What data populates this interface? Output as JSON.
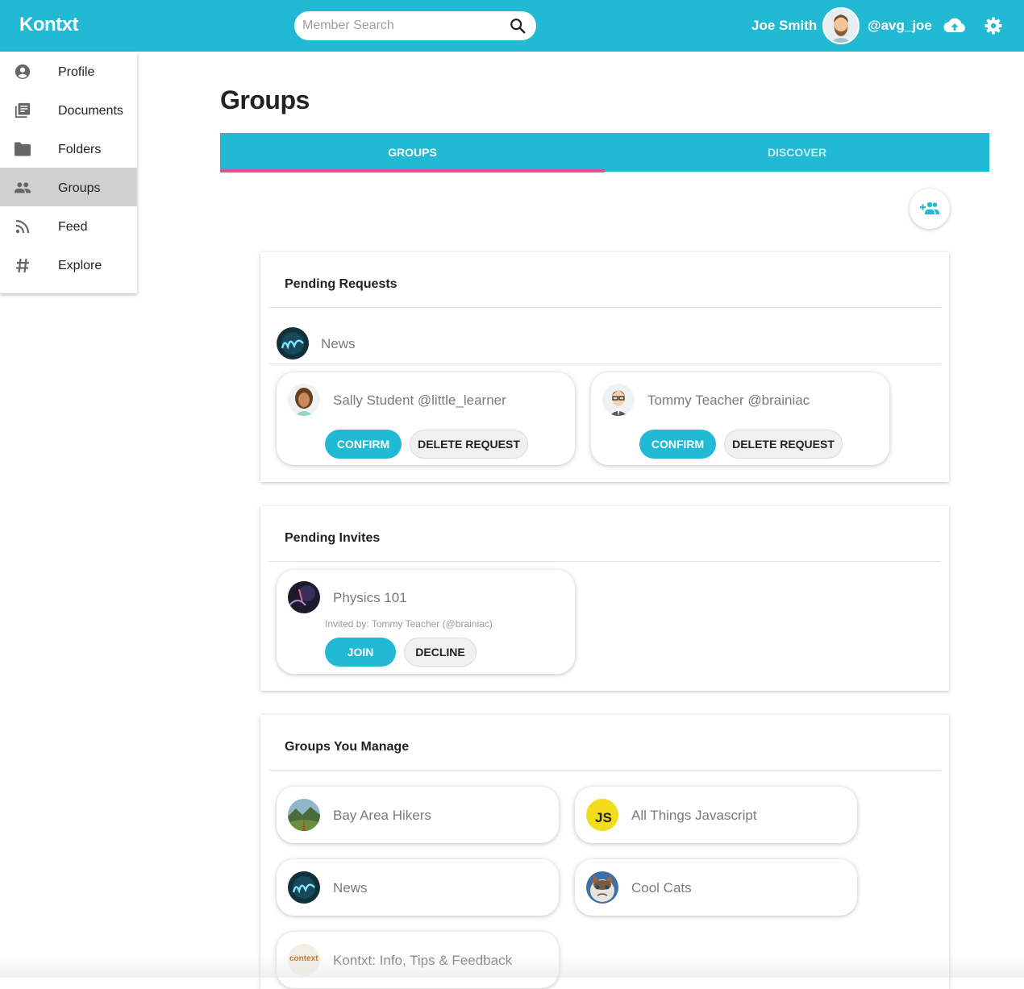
{
  "app": {
    "brand": "Kontxt"
  },
  "header": {
    "search_placeholder": "Member Search",
    "user_name": "Joe Smith",
    "user_handle": "@avg_joe"
  },
  "sidebar": {
    "items": [
      {
        "label": "Profile",
        "icon": "account-circle-icon"
      },
      {
        "label": "Documents",
        "icon": "documents-icon"
      },
      {
        "label": "Folders",
        "icon": "folder-icon"
      },
      {
        "label": "Groups",
        "icon": "people-icon",
        "active": true
      },
      {
        "label": "Feed",
        "icon": "rss-icon"
      },
      {
        "label": "Explore",
        "icon": "hashtag-icon"
      }
    ]
  },
  "main": {
    "title": "Groups",
    "tabs": [
      {
        "label": "GROUPS",
        "active": true
      },
      {
        "label": "DISCOVER",
        "active": false
      }
    ]
  },
  "pending_requests": {
    "title": "Pending Requests",
    "group_name": "News",
    "requests": [
      {
        "name": "Sally Student @little_learner",
        "confirm_label": "CONFIRM",
        "delete_label": "DELETE REQUEST"
      },
      {
        "name": "Tommy Teacher @brainiac",
        "confirm_label": "CONFIRM",
        "delete_label": "DELETE REQUEST"
      }
    ]
  },
  "pending_invites": {
    "title": "Pending Invites",
    "invites": [
      {
        "group_name": "Physics 101",
        "invited_by": "Invited by: Tommy Teacher (@brainiac)",
        "join_label": "JOIN",
        "decline_label": "DECLINE"
      }
    ]
  },
  "groups_you_manage": {
    "title": "Groups You Manage",
    "groups": [
      {
        "name": "Bay Area Hikers"
      },
      {
        "name": "All Things Javascript",
        "avatar_text": "JS"
      },
      {
        "name": "News"
      },
      {
        "name": "Cool Cats"
      },
      {
        "name": "Kontxt: Info, Tips & Feedback",
        "avatar_text": "context"
      }
    ]
  },
  "colors": {
    "primary": "#22b9d4",
    "tab_indicator": "#e8508a",
    "active_nav": "#d0d0d0"
  }
}
